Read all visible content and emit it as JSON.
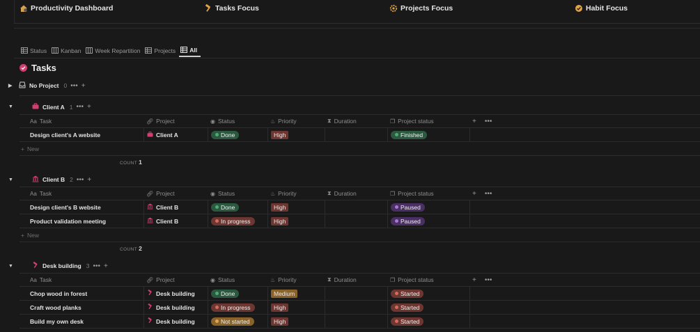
{
  "top_links": [
    {
      "label": "Productivity Dashboard",
      "icon": "house-icon"
    },
    {
      "label": "Tasks Focus",
      "icon": "hammer-icon"
    },
    {
      "label": "Projects Focus",
      "icon": "gear-icon"
    },
    {
      "label": "Habit Focus",
      "icon": "check-badge-icon"
    }
  ],
  "views": [
    {
      "label": "Status",
      "icon": "table-icon"
    },
    {
      "label": "Kanban",
      "icon": "board-icon"
    },
    {
      "label": "Week Repartition",
      "icon": "board-icon"
    },
    {
      "label": "Projects",
      "icon": "table-icon"
    },
    {
      "label": "All",
      "icon": "table-icon",
      "active": true
    }
  ],
  "title": "Tasks",
  "columns": {
    "task": "Task",
    "task_prefix": "Aa",
    "project": "Project",
    "status": "Status",
    "priority": "Priority",
    "duration": "Duration",
    "project_status": "Project status"
  },
  "new_label": "New",
  "count_label": "COUNT",
  "colors": {
    "done": "#2b593f",
    "done_dot": "#4dab6f",
    "in_progress": "#6e3630",
    "in_progress_dot": "#d96a5b",
    "not_started": "#89632a",
    "not_started_dot": "#e0a64d",
    "high": "#6e3630",
    "medium": "#89632a",
    "paused": "#492f64",
    "paused_dot": "#a678d4",
    "started": "#6e3630",
    "started_dot": "#d96a5b",
    "finished": "#2b593f",
    "finished_dot": "#4dab6f"
  },
  "groups": {
    "no_project": {
      "name": "No Project",
      "count": "0"
    },
    "client_a": {
      "name": "Client A",
      "count": "1",
      "total": "1",
      "rows": [
        {
          "task": "Design client's A website",
          "project": "Client A",
          "status": "Done",
          "priority": "High",
          "project_status": "Finished"
        }
      ]
    },
    "client_b": {
      "name": "Client B",
      "count": "2",
      "total": "2",
      "rows": [
        {
          "task": "Design client's B website",
          "project": "Client B",
          "status": "Done",
          "priority": "High",
          "project_status": "Paused"
        },
        {
          "task": "Product validation meeting",
          "project": "Client B",
          "status": "In progress",
          "priority": "High",
          "project_status": "Paused"
        }
      ]
    },
    "desk_building": {
      "name": "Desk building",
      "count": "3",
      "rows": [
        {
          "task": "Chop wood in forest",
          "project": "Desk building",
          "status": "Done",
          "priority": "Medium",
          "project_status": "Started"
        },
        {
          "task": "Craft wood planks",
          "project": "Desk building",
          "status": "In progress",
          "priority": "High",
          "project_status": "Started"
        },
        {
          "task": "Build my own desk",
          "project": "Desk building",
          "status": "Not started",
          "priority": "High",
          "project_status": "Started"
        }
      ]
    }
  }
}
